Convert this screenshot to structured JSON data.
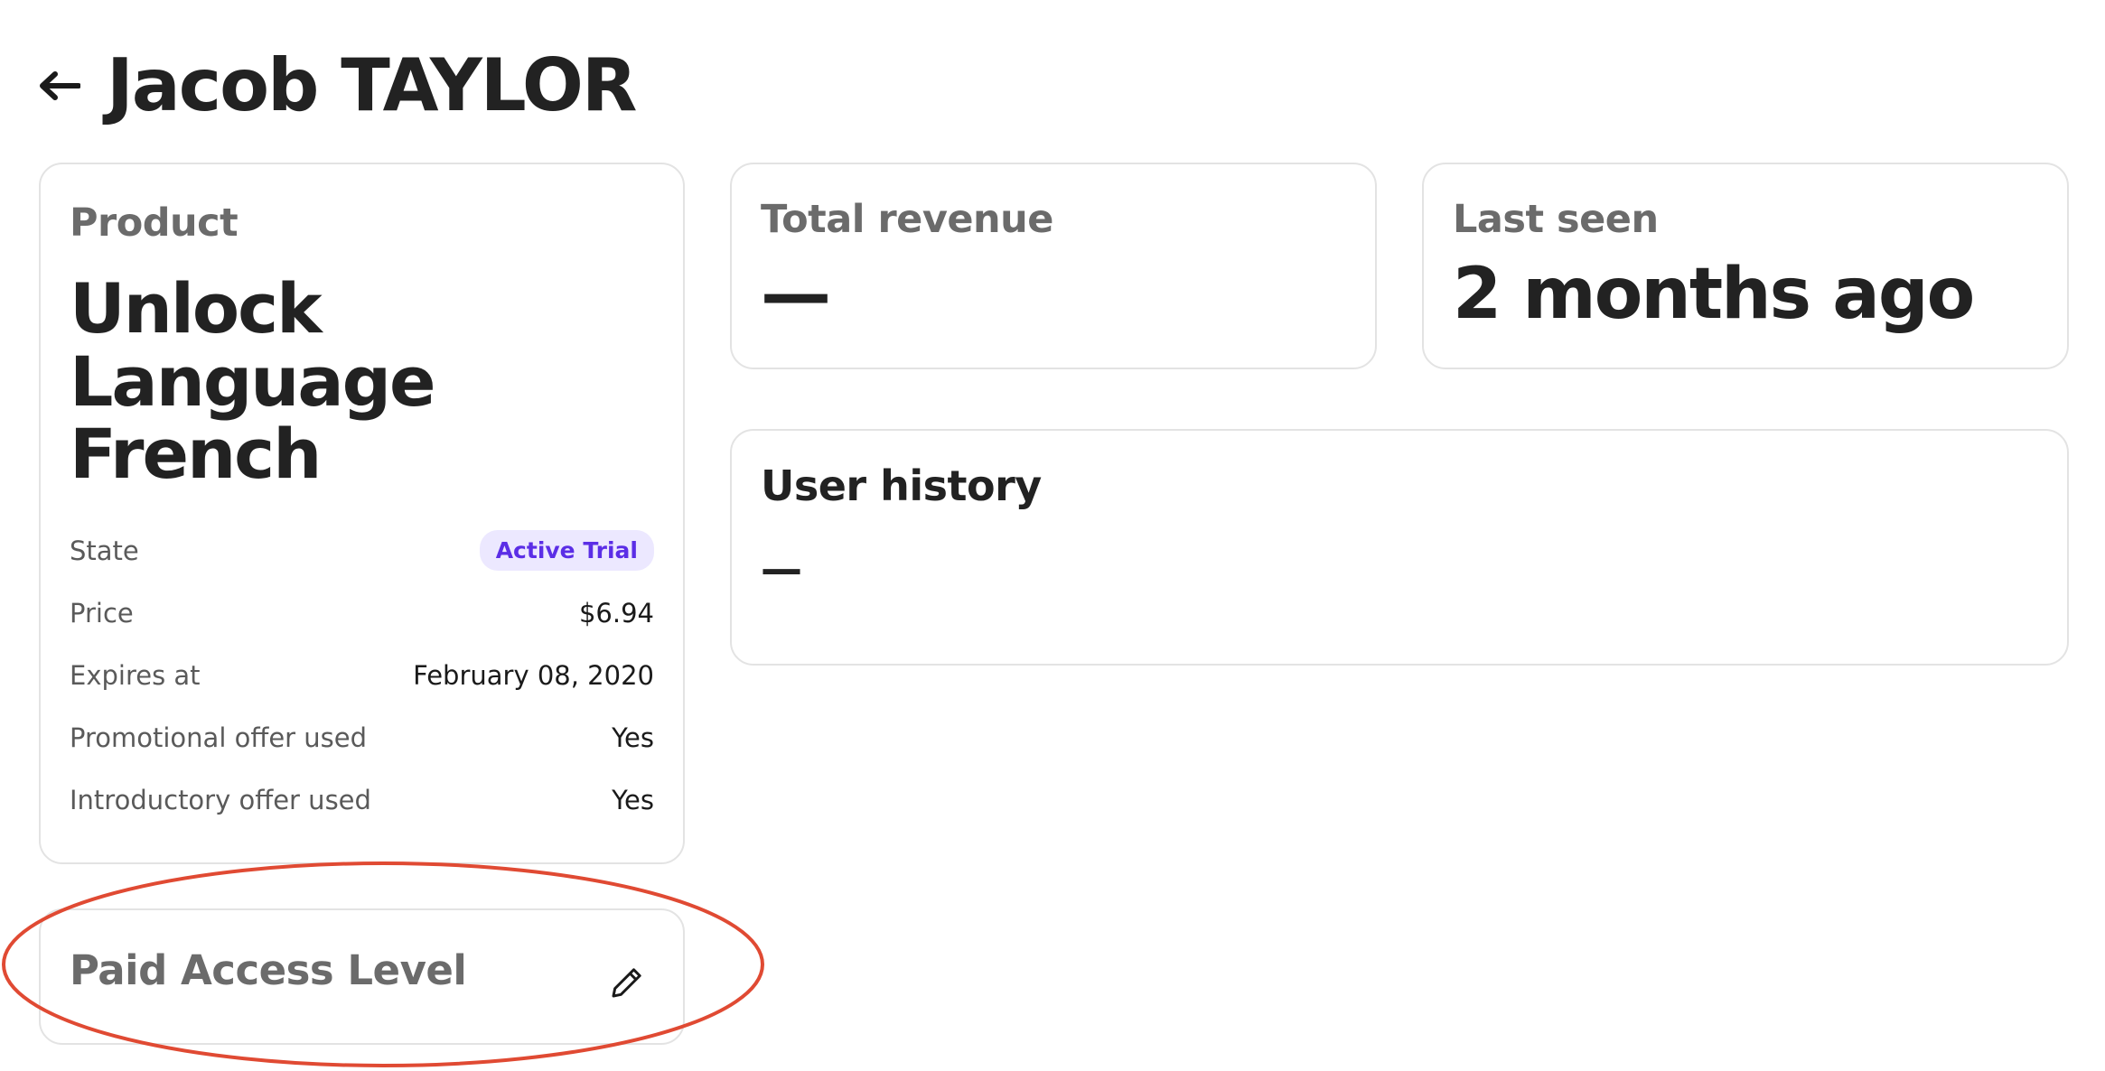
{
  "header": {
    "title": "Jacob TAYLOR",
    "back_icon": "arrow-left-icon"
  },
  "product_card": {
    "label": "Product",
    "name": "Unlock Language French",
    "details": [
      {
        "label": "State",
        "value": "Active Trial",
        "type": "badge"
      },
      {
        "label": "Price",
        "value": "$6.94"
      },
      {
        "label": "Expires at",
        "value": "February 08, 2020"
      },
      {
        "label": "Promotional offer used",
        "value": "Yes"
      },
      {
        "label": "Introductory offer used",
        "value": "Yes"
      }
    ]
  },
  "revenue_card": {
    "label": "Total revenue",
    "value": "—"
  },
  "last_seen_card": {
    "label": "Last seen",
    "value": "2 months ago"
  },
  "history_card": {
    "title": "User history",
    "value": "—"
  },
  "access_card": {
    "label": "Paid Access Level",
    "edit_icon": "pencil-icon"
  },
  "colors": {
    "badge_bg": "#ece8ff",
    "badge_text": "#5b2ee6",
    "annotation": "#e04a33",
    "card_border": "#e3e3e3"
  }
}
